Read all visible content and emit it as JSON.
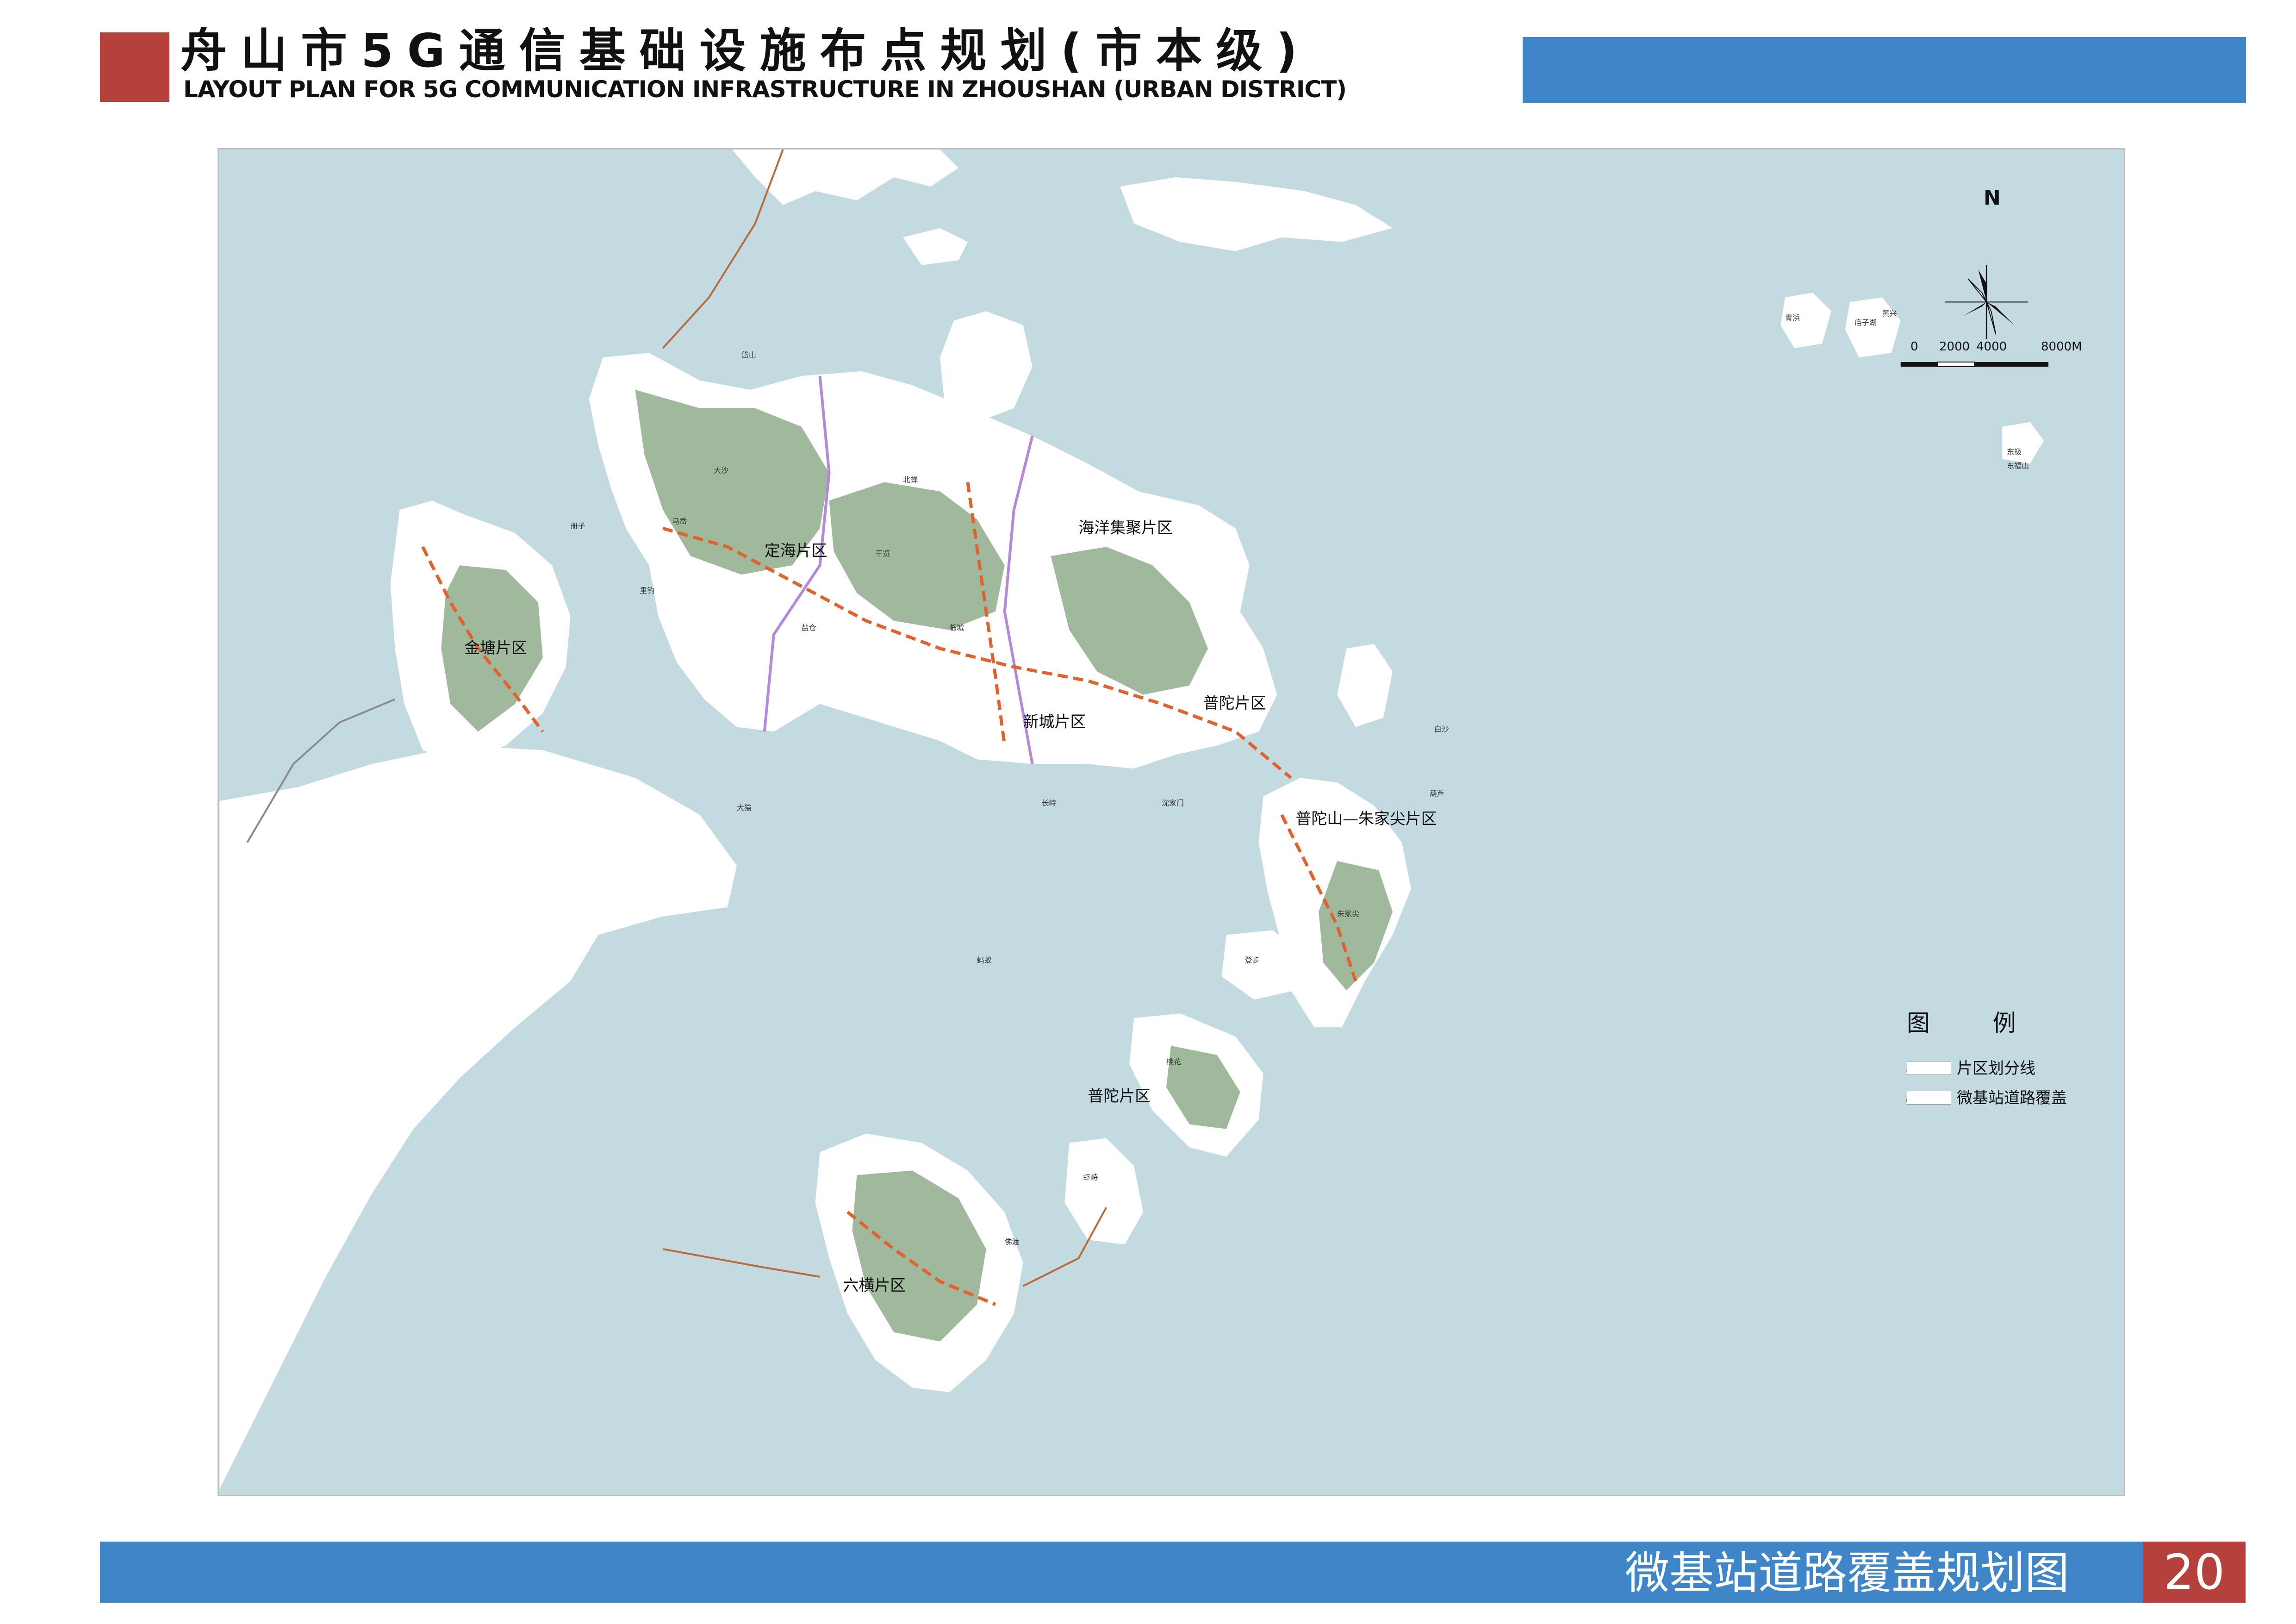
{
  "header": {
    "title_cn": "舟山市5G通信基础设施布点规划(市本级)",
    "title_en": "LAYOUT PLAN FOR 5G COMMUNICATION INFRASTRUCTURE IN ZHOUSHAN (URBAN DISTRICT)"
  },
  "footer": {
    "title": "微基站道路覆盖规划图",
    "page_number": "20"
  },
  "colors": {
    "accent_red": "#b4413c",
    "accent_blue": "#3f86c8",
    "sea": "#c3dbe0",
    "land": "#ffffff",
    "forest": "#8fac8a",
    "district_line": "#b48ad8",
    "road_coverage": "#e0622e"
  },
  "compass": {
    "north_label": "N",
    "icon": "compass-rose-icon"
  },
  "scale_bar": {
    "labels": [
      "0",
      "2000",
      "4000",
      "8000M"
    ]
  },
  "legend": {
    "title": "图  例",
    "items": [
      {
        "label": "片区划分线",
        "icon": "district-boundary-line-icon"
      },
      {
        "label": "微基站道路覆盖",
        "icon": "dashed-road-coverage-icon"
      }
    ]
  },
  "map": {
    "district_labels": [
      "定海片区",
      "海洋集聚片区",
      "金塘片区",
      "新城片区",
      "普陀片区",
      "普陀山—朱家尖片区",
      "普陀片区",
      "六横片区"
    ],
    "place_labels": [
      "岱山",
      "大沙",
      "北蝉",
      "马岙",
      "干览",
      "盐仓",
      "临城",
      "沈家门",
      "朱家尖",
      "桃花",
      "虾峙",
      "佛渡",
      "大猫",
      "册子",
      "里钓",
      "东极",
      "庙子湖",
      "青浜",
      "黄兴",
      "东福山",
      "长峙",
      "登步",
      "蚂蚁",
      "白沙",
      "葫芦"
    ]
  }
}
